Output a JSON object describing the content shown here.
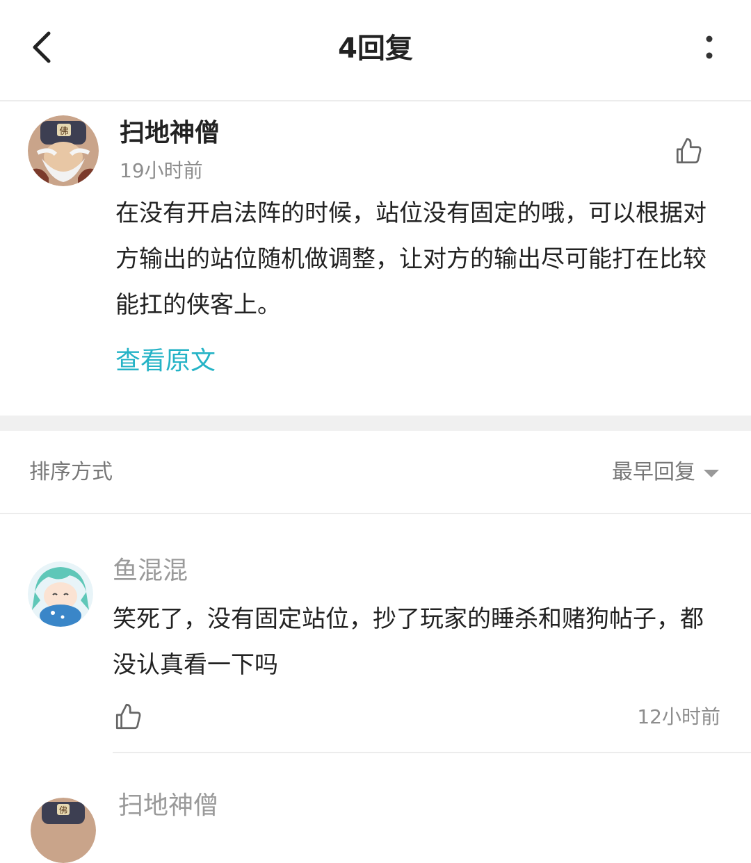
{
  "header": {
    "title": "4回复"
  },
  "post": {
    "author": "扫地神僧",
    "time": "19小时前",
    "content": "在没有开启法阵的时候，站位没有固定的哦，可以根据对方输出的站位随机做调整，让对方的输出尽可能打在比较能扛的侠客上。",
    "view_original": "查看原文"
  },
  "sort": {
    "label": "排序方式",
    "value": "最早回复"
  },
  "replies": [
    {
      "author": "鱼混混",
      "content": "笑死了，没有固定站位，抄了玩家的睡杀和赌狗帖子，都没认真看一下吗",
      "time": "12小时前"
    },
    {
      "author": "扫地神僧"
    }
  ],
  "colors": {
    "accent": "#24b3c6",
    "muted": "#8d8d8d",
    "divider": "#f0f0f0"
  }
}
